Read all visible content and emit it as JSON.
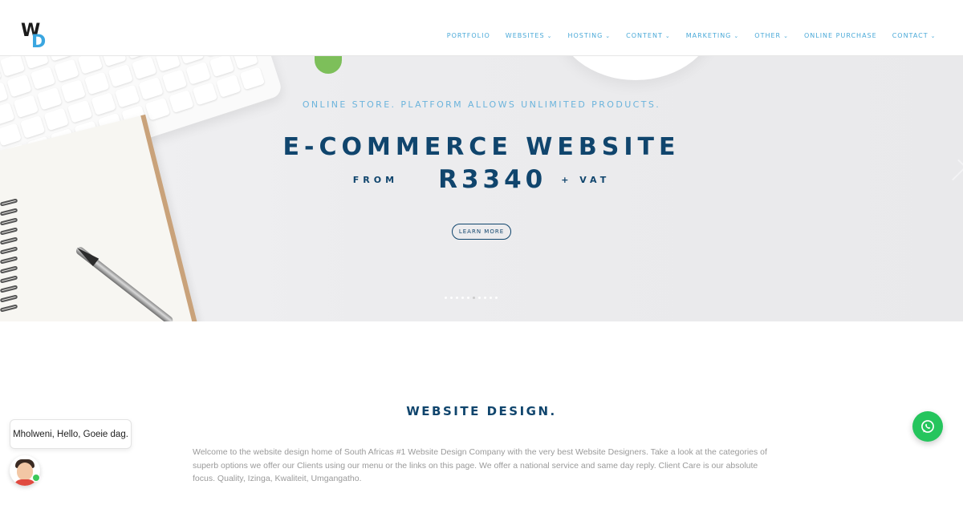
{
  "brand": {
    "logo_letter_1": "W",
    "logo_letter_2": "D",
    "accent": "#3aa6e0",
    "navy": "#10456d"
  },
  "nav": {
    "items": [
      {
        "label": "PORTFOLIO",
        "dropdown": false
      },
      {
        "label": "WEBSITES",
        "dropdown": true
      },
      {
        "label": "HOSTING",
        "dropdown": true
      },
      {
        "label": "CONTENT",
        "dropdown": true
      },
      {
        "label": "MARKETING",
        "dropdown": true
      },
      {
        "label": "OTHER",
        "dropdown": true
      },
      {
        "label": "ONLINE PURCHASE",
        "dropdown": false
      },
      {
        "label": "CONTACT",
        "dropdown": true
      }
    ]
  },
  "hero": {
    "tagline": "ONLINE STORE. PLATFORM ALLOWS UNLIMITED PRODUCTS.",
    "headline": "E-COMMERCE WEBSITE",
    "price_prefix": "FROM",
    "price": "R3340",
    "price_suffix": "+ VAT",
    "cta_label": "LEARN MORE",
    "slide_count": 10,
    "active_slide": 5
  },
  "main": {
    "title": "WEBSITE DESIGN.",
    "intro": "Welcome to the website design home of South Africas #1 Website Design Company with the very best Website Designers. Take a look at the categories of superb options we offer our Clients using our menu or the links on this page. We offer a national service and same day reply. Client Care is our absolute focus. Quality, Izinga, Kwaliteit, Umgangatho."
  },
  "chat": {
    "greeting": "Mholweni, Hello, Goeie dag.",
    "status_color": "#3cc85a",
    "whatsapp_color": "#25c55d",
    "whatsapp_icon": "whatsapp-icon"
  }
}
